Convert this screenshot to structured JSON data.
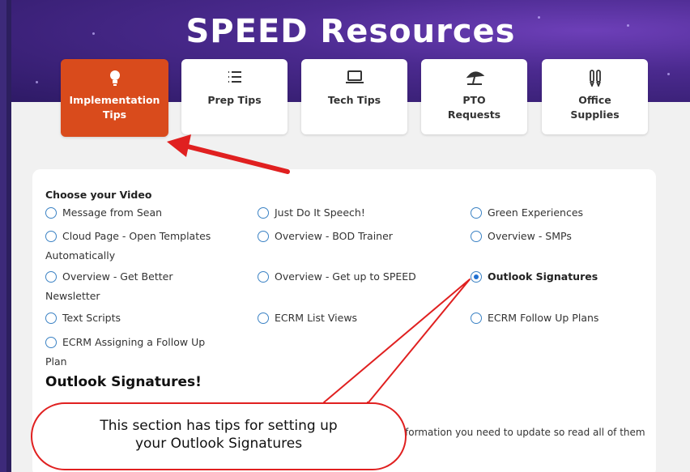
{
  "header": {
    "title": "SPEED Resources"
  },
  "tabs": [
    {
      "label_line1": "Implementation",
      "label_line2": "Tips",
      "icon": "lightbulb-icon",
      "active": true
    },
    {
      "label_line1": "Prep Tips",
      "label_line2": "",
      "icon": "list-icon",
      "active": false
    },
    {
      "label_line1": "Tech Tips",
      "label_line2": "",
      "icon": "laptop-icon",
      "active": false
    },
    {
      "label_line1": "PTO",
      "label_line2": "Requests",
      "icon": "beach-umbrella-icon",
      "active": false
    },
    {
      "label_line1": "Office",
      "label_line2": "Supplies",
      "icon": "pens-icon",
      "active": false
    }
  ],
  "video": {
    "prompt": "Choose your Video",
    "options": [
      {
        "line1": "Message from Sean",
        "line2": "",
        "selected": false
      },
      {
        "line1": "Just Do It Speech!",
        "line2": "",
        "selected": false
      },
      {
        "line1": "Green Experiences",
        "line2": "",
        "selected": false
      },
      {
        "line1": "Cloud Page - Open Templates",
        "line2": "Automatically",
        "selected": false
      },
      {
        "line1": "Overview - BOD Trainer",
        "line2": "",
        "selected": false
      },
      {
        "line1": "Overview - SMPs",
        "line2": "",
        "selected": false
      },
      {
        "line1": "Overview - Get Better",
        "line2": "Newsletter",
        "selected": false
      },
      {
        "line1": "Overview - Get up to SPEED",
        "line2": "",
        "selected": false
      },
      {
        "line1": "Outlook Signatures",
        "line2": "",
        "selected": true
      },
      {
        "line1": "Text Scripts",
        "line2": "",
        "selected": false
      },
      {
        "line1": "ECRM List Views",
        "line2": "",
        "selected": false
      },
      {
        "line1": "ECRM Follow Up Plans",
        "line2": "",
        "selected": false
      },
      {
        "line1": "ECRM Assigning a Follow Up",
        "line2": "Plan",
        "selected": false
      }
    ]
  },
  "section": {
    "title": "Outlook Signatures!",
    "body_fragment": "formation you need to update so read all of them"
  },
  "callout": {
    "line1": "This section has tips for setting up",
    "line2": "your Outlook Signatures"
  },
  "colors": {
    "accent": "#d94b1c",
    "callout_border": "#e02020",
    "radio": "#1f6fd1"
  }
}
